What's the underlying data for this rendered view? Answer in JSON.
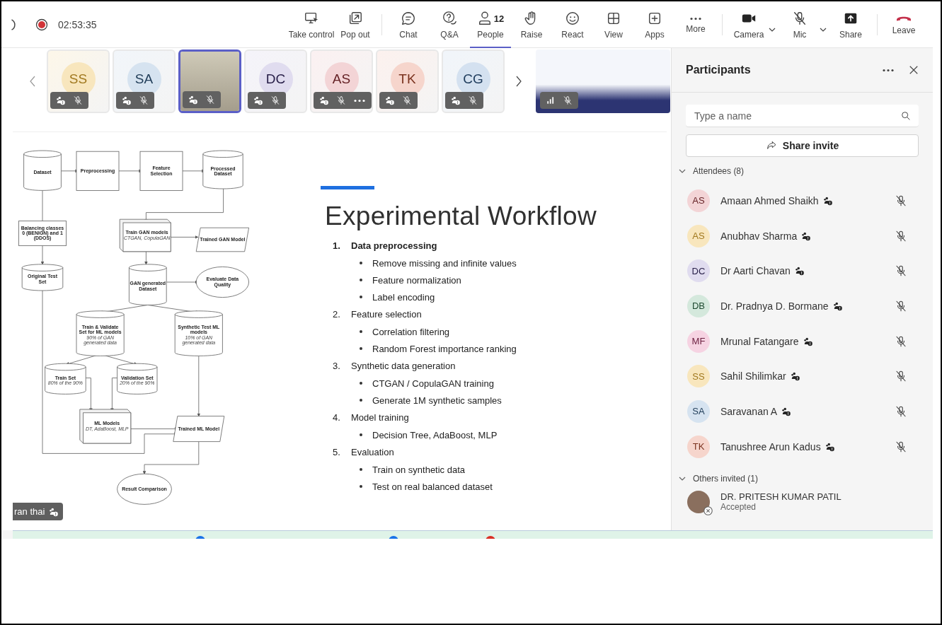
{
  "meeting": {
    "time": "02:53:35",
    "recording": true
  },
  "toolbar": [
    {
      "kind": "button",
      "label": "Take control",
      "selected": false
    },
    {
      "kind": "button",
      "label": "Pop out",
      "selected": false
    },
    {
      "kind": "separator"
    },
    {
      "kind": "button",
      "label": "Chat",
      "selected": false
    },
    {
      "kind": "button",
      "label": "Q&A",
      "selected": false
    },
    {
      "kind": "button",
      "label": "People",
      "count": "12",
      "selected": true
    },
    {
      "kind": "button",
      "label": "Raise",
      "selected": false
    },
    {
      "kind": "button",
      "label": "React",
      "selected": false
    },
    {
      "kind": "button",
      "label": "View",
      "selected": false
    },
    {
      "kind": "button",
      "label": "Apps",
      "selected": false
    },
    {
      "kind": "button",
      "label": "More",
      "selected": false
    },
    {
      "kind": "separator"
    },
    {
      "kind": "dropdown",
      "label": "Camera",
      "selected": false
    },
    {
      "kind": "dropdown",
      "label": "Mic",
      "selected": false
    },
    {
      "kind": "button",
      "label": "Share",
      "selected": false
    },
    {
      "kind": "separator"
    },
    {
      "kind": "leave",
      "label": "Leave",
      "selected": false
    }
  ],
  "filmstrip": [
    {
      "kind": "avatar",
      "initials": "SS",
      "color": "#f8e6bd",
      "menu": false,
      "selected": false
    },
    {
      "kind": "avatar",
      "initials": "SA",
      "color": "#d6e3f0",
      "menu": false,
      "selected": false
    },
    {
      "kind": "video",
      "menu": false,
      "selected": true
    },
    {
      "kind": "avatar",
      "initials": "DC",
      "color": "#e0dcef",
      "menu": false,
      "selected": false
    },
    {
      "kind": "avatar",
      "initials": "AS",
      "color": "#f3d4d6",
      "menu": true,
      "selected": false
    },
    {
      "kind": "avatar",
      "initials": "TK",
      "color": "#f6d5cc",
      "menu": false,
      "selected": false
    },
    {
      "kind": "avatar",
      "initials": "CG",
      "color": "#d4e1f0",
      "menu": false,
      "selected": false
    }
  ],
  "slide": {
    "title": "Experimental Workflow",
    "workflow_diagram": [
      {
        "kind": "cylinder",
        "title": "Dataset"
      },
      {
        "kind": "rect",
        "title": "Preprocessing"
      },
      {
        "kind": "rect",
        "title": "Feature Selection"
      },
      {
        "kind": "cylinder",
        "title": "Processed Dataset"
      },
      {
        "kind": "rect",
        "title": "Balancing classes 0 (BENIGN) and 1 (DDOS)"
      },
      {
        "kind": "box3d",
        "title": "Train GAN models",
        "detail": "CTGAN, CopulaGAN"
      },
      {
        "kind": "parallelogram",
        "title": "Trained GAN Model"
      },
      {
        "kind": "cylinder",
        "title": "Original Test Set"
      },
      {
        "kind": "cylinder",
        "title": "GAN generated Dataset"
      },
      {
        "kind": "ellipse",
        "title": "Evaluate Data Quality"
      },
      {
        "kind": "cylinder",
        "title": "Train & Validate Set for ML models",
        "detail": "90% of GAN generated data"
      },
      {
        "kind": "cylinder",
        "title": "Synthetic Test ML models",
        "detail": "10% of GAN generated data"
      },
      {
        "kind": "cylinder",
        "title": "Train Set",
        "detail": "80% of the 90%"
      },
      {
        "kind": "cylinder",
        "title": "Validation Set",
        "detail": "20% of the 90%"
      },
      {
        "kind": "box3d",
        "title": "ML Models",
        "detail": "DT, AdaBoost, MLP"
      },
      {
        "kind": "parallelogram",
        "title": "Trained ML Model"
      },
      {
        "kind": "ellipse",
        "title": "Result Comparison"
      }
    ],
    "steps": [
      {
        "number": "1.",
        "text": "Data preprocessing",
        "bold": true,
        "bullets": [
          "Remove missing and infinite values",
          "Feature normalization",
          "Label encoding"
        ]
      },
      {
        "number": "2.",
        "text": "Feature selection",
        "bold": false,
        "bullets": [
          "Correlation filtering",
          "Random Forest importance ranking"
        ]
      },
      {
        "number": "3.",
        "text": "Synthetic data generation",
        "bold": false,
        "bullets": [
          "CTGAN / CopulaGAN training",
          "Generate 1M synthetic samples"
        ]
      },
      {
        "number": "4.",
        "text": "Model training",
        "bold": false,
        "bullets": [
          "Decision Tree, AdaBoost,  MLP"
        ]
      },
      {
        "number": "5.",
        "text": "Evaluation",
        "bold": false,
        "bullets": [
          "Train on synthetic data",
          "Test on real balanced dataset"
        ]
      }
    ]
  },
  "presenter_label": {
    "name": "ran thai"
  },
  "participants": {
    "title": "Participants",
    "search": {
      "placeholder": "Type a name"
    },
    "share_button": "Share invite",
    "groups": [
      {
        "label": "Attendees (8)",
        "expanded": true,
        "people": [
          {
            "initials": "AS",
            "name": "Amaan Ahmed Shaikh",
            "color": "#f3d4d6",
            "muted": true
          },
          {
            "initials": "AS",
            "name": "Anubhav Sharma",
            "color": "#f8e6bd",
            "muted": true
          },
          {
            "initials": "DC",
            "name": "Dr Aarti Chavan",
            "color": "#e0dcef",
            "muted": true
          },
          {
            "initials": "DB",
            "name": "Dr. Pradnya D. Bormane",
            "color": "#d4e8dc",
            "muted": true
          },
          {
            "initials": "MF",
            "name": "Mrunal Fatangare",
            "color": "#f6d3e2",
            "muted": true
          },
          {
            "initials": "SS",
            "name": "Sahil Shilimkar",
            "color": "#f8e6bd",
            "muted": true
          },
          {
            "initials": "SA",
            "name": "Saravanan A",
            "color": "#d6e3f0",
            "muted": true
          },
          {
            "initials": "TK",
            "name": "Tanushree Arun Kadus",
            "color": "#f6d5cc",
            "muted": true
          }
        ]
      },
      {
        "label": "Others invited (1)",
        "expanded": true,
        "invited": [
          {
            "name": "DR. PRITESH KUMAR PATIL",
            "status": "Accepted"
          }
        ]
      }
    ]
  }
}
